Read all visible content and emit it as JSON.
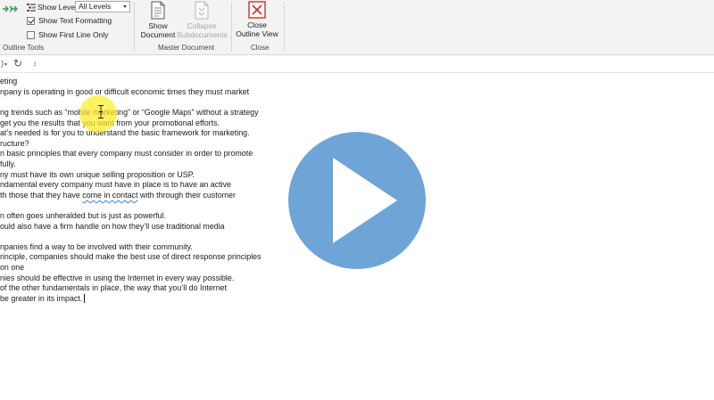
{
  "ribbon": {
    "outline_tools": {
      "show_level_label": "Show Level:",
      "show_level_value": "All Levels",
      "show_text_formatting_label": "Show Text Formatting",
      "show_text_formatting_checked": true,
      "show_first_line_only_label": "Show First Line Only",
      "show_first_line_only_checked": false,
      "group_label": "Outline Tools"
    },
    "master_document": {
      "show_document_line1": "Show",
      "show_document_line2": "Document",
      "collapse_line1": "Collapse",
      "collapse_line2": "Subdocuments",
      "group_label": "Master Document"
    },
    "close": {
      "close_outline_line1": "Close",
      "close_outline_line2": "Outline View",
      "group_label": "Close"
    }
  },
  "quick_access": {
    "undo_glyph": "↻",
    "customize_glyph": "↕"
  },
  "document": {
    "lines": [
      "eting",
      "npany is operating in good or difficult economic times they must market",
      "",
      "ng trends such as “mobile marketing” or “Google Maps” without a strategy",
      "get you the results that you want from your promotional efforts.",
      "at’s needed is for you to understand the basic framework for marketing.",
      "ructure?",
      "n basic principles that every company must consider in order to promote",
      "fully.",
      "ny must have its own unique selling proposition or USP.",
      "ndamental every company must have in place is to have an active",
      "th those that they have come in contact with through their customer",
      "",
      "n often goes unheralded but is just as powerful.",
      "ould also have a firm handle on how they’ll use traditional media",
      "",
      "npanies find a way to be involved with their community.",
      "rinciple, companies should make the best use of direct response principles",
      "on one",
      "nies should be effective in using the Internet in every way possible.",
      "of the other fundamentals in place, the way that you’ll do Internet",
      "be greater in its impact."
    ],
    "misspelled_word": "come in contact"
  },
  "video": {
    "play_icon": "play-icon",
    "play_color": "#6fa4d7"
  },
  "colors": {
    "ribbon_bg": "#f3f3f3",
    "close_icon_red": "#d22b2b",
    "outline_arrow_green": "#2e9e4f",
    "highlight_yellow": "#ffec28"
  }
}
